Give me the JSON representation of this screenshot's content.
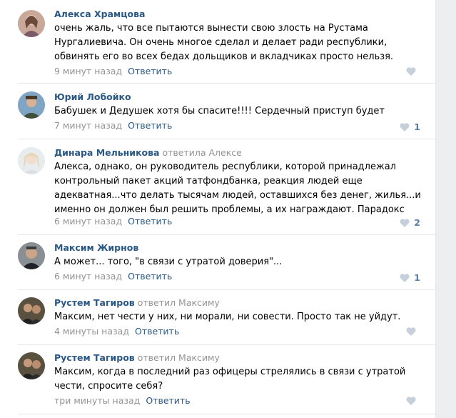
{
  "reply_label": "Ответить",
  "comments": [
    {
      "author": "Алекса Храмцова",
      "reply_to": "",
      "text": [
        "очень жаль, что все пытаются вынести свою злость на Рустама",
        "Нургалиевича. Он очень многое сделал и делает ради республики,",
        "обвинять его во всех бедах дольщиков и вкладчиках просто нельзя."
      ],
      "time": "9 минут назад",
      "likes": ""
    },
    {
      "author": "Юрий Лобойко",
      "reply_to": "",
      "text": [
        "Бабушек и Дедушек хотя бы спасите!!!! Сердечный приступ будет"
      ],
      "time": "7 минут назад",
      "likes": "1"
    },
    {
      "author": "Динара Мельникова",
      "reply_to": "ответила Алексе",
      "text": [
        "Алекса, однако, он руководитель республики, которой принадлежал",
        "контрольный пакет акций татфондбанка, реакция людей еще",
        "адекватная...что делать тысячам людей, оставшихся без денег, жилья...и",
        "именно он должен был решить проблемы, а их награждают. Парадокс"
      ],
      "time": "6 минут назад",
      "likes": "2"
    },
    {
      "author": "Максим Жирнов",
      "reply_to": "",
      "text": [
        "А может... того, \"в связи с утратой доверия\"..."
      ],
      "time": "6 минут назад",
      "likes": "1"
    },
    {
      "author": "Рустем Тагиров",
      "reply_to": "ответил Максиму",
      "text": [
        "Максим, нет чести у них, ни морали, ни совести. Просто так не уйдут."
      ],
      "time": "4 минуты назад",
      "likes": ""
    },
    {
      "author": "Рустем Тагиров",
      "reply_to": "ответил Максиму",
      "text": [
        "Максим, когда в последний раз офицеры стрелялись в связи с утратой",
        "чести, спросите себя?"
      ],
      "time": "три минуты назад",
      "likes": ""
    }
  ]
}
